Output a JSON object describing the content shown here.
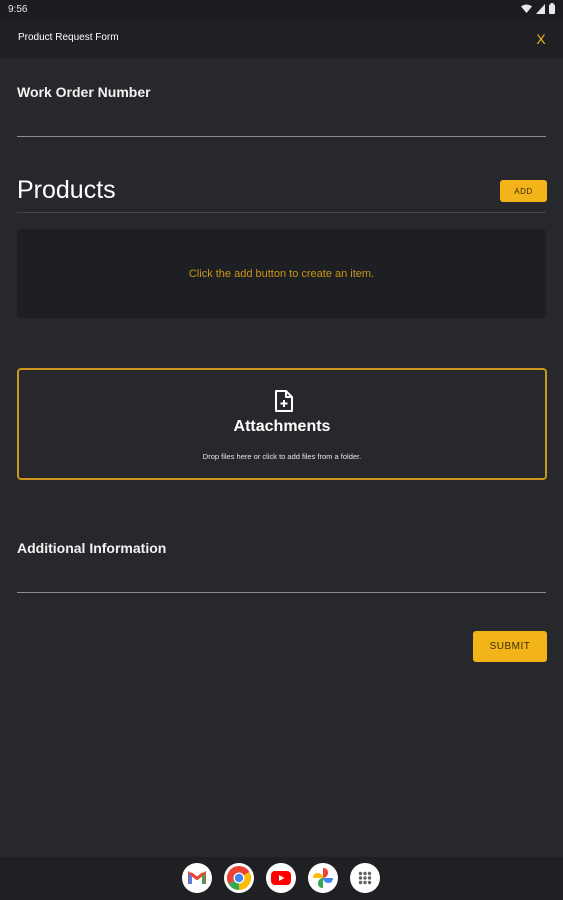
{
  "status_bar": {
    "time": "9:56"
  },
  "header": {
    "title": "Product Request Form",
    "close_label": "X"
  },
  "form": {
    "work_order_label": "Work Order Number",
    "work_order_value": "",
    "products_title": "Products",
    "add_label": "ADD",
    "empty_message": "Click the add button to create an item.",
    "attachments_title": "Attachments",
    "attachments_hint": "Drop files here or click to add files from a folder.",
    "additional_label": "Additional Information",
    "additional_value": "",
    "submit_label": "SUBMIT"
  },
  "dock": {
    "apps": [
      "gmail-icon",
      "chrome-icon",
      "youtube-icon",
      "photos-icon",
      "app-drawer-icon"
    ]
  },
  "colors": {
    "accent": "#f2b418",
    "accent_text": "#c9961b",
    "background": "#27282c",
    "panel": "#1e1f22"
  }
}
